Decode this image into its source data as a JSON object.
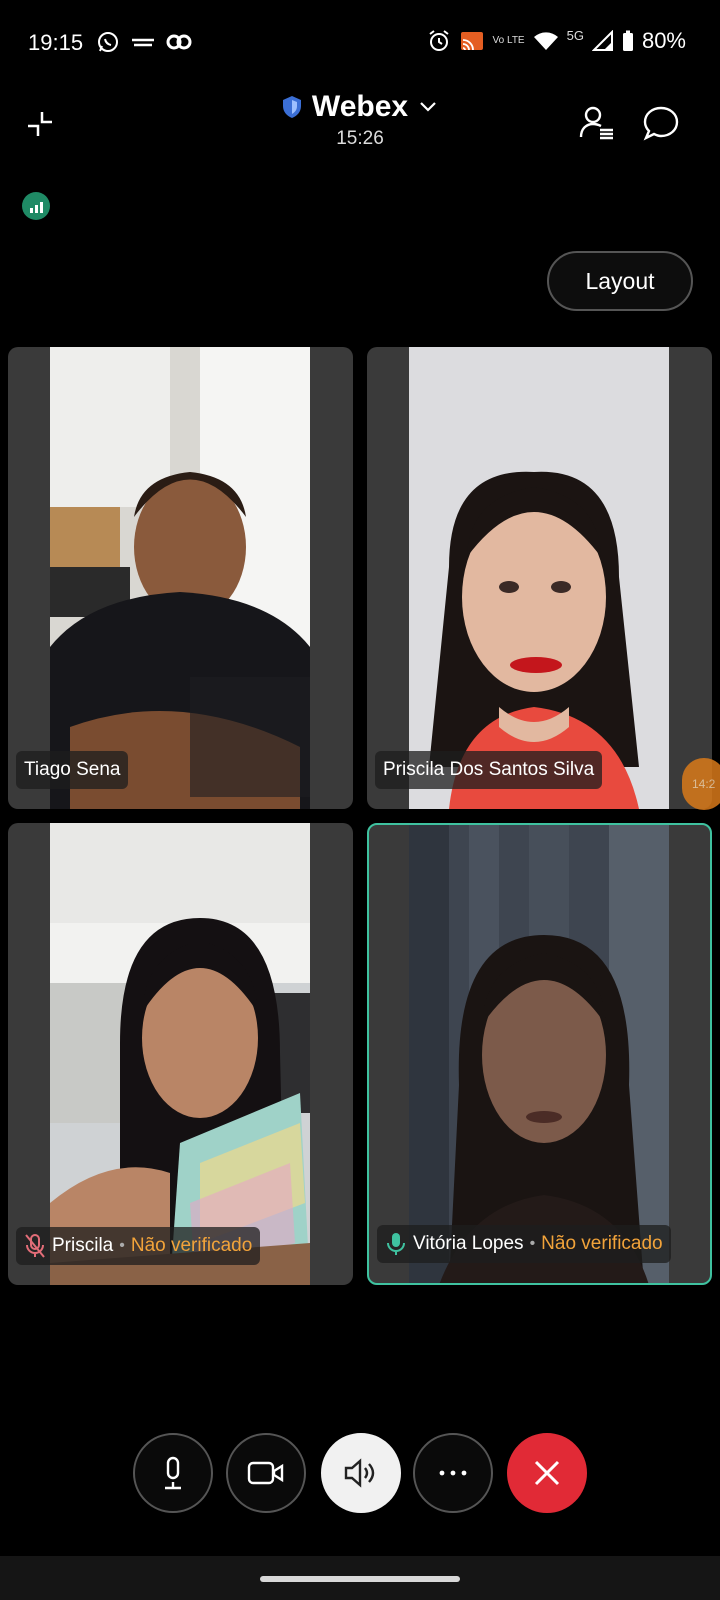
{
  "status_bar": {
    "time": "19:15",
    "battery": "80%",
    "network_type": "5G",
    "volte_label": "Vo LTE",
    "app_icons": [
      "whatsapp-icon",
      "ifood-icon",
      "webtoon-icon"
    ],
    "system_icons": [
      "alarm-icon",
      "cast-icon",
      "volte-icon",
      "wifi-icon",
      "signal-icon",
      "battery-icon"
    ]
  },
  "header": {
    "title": "Webex",
    "timer": "15:26",
    "icons": [
      "minimize-icon",
      "shield-icon",
      "chevron-down-icon",
      "participants-icon",
      "chat-icon"
    ]
  },
  "layout_button": {
    "label": "Layout"
  },
  "participants": [
    {
      "name": "Tiago Sena",
      "status": "",
      "muted": false
    },
    {
      "name": "Priscila Dos Santos Silva",
      "status": "",
      "muted": false
    },
    {
      "name": "Priscila",
      "status": "Não verificado",
      "muted": true
    },
    {
      "name": "Vitória Lopes",
      "status": "Não verificado",
      "muted": false,
      "speaking": true
    }
  ],
  "side_pill": {
    "label": "14:2"
  },
  "controls": {
    "items": [
      "microphone",
      "camera",
      "speaker",
      "more",
      "end-call"
    ],
    "colors": {
      "end": "#e12a36",
      "accent": "#3fc2a0",
      "warning": "#f2a33a"
    }
  }
}
